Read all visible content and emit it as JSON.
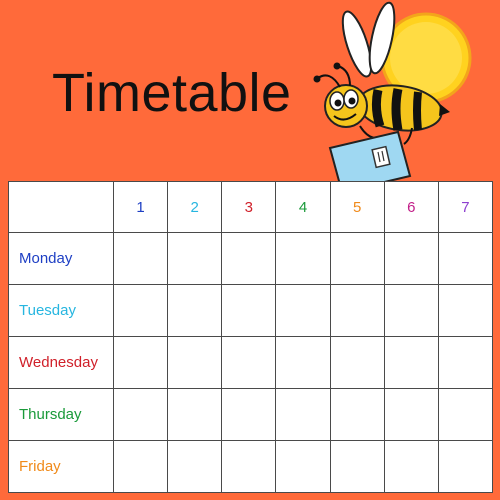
{
  "title": "Timetable",
  "periods": [
    "1",
    "2",
    "3",
    "4",
    "5",
    "6",
    "7"
  ],
  "period_colors": [
    "#1e3fc4",
    "#27b6e0",
    "#d0202a",
    "#1a9a3a",
    "#f08a1a",
    "#c21e88",
    "#8d3fcf"
  ],
  "days": [
    {
      "label": "Monday",
      "color": "#1e3fc4"
    },
    {
      "label": "Tuesday",
      "color": "#27b6e0"
    },
    {
      "label": "Wednesday",
      "color": "#d0202a"
    },
    {
      "label": "Thursday",
      "color": "#1a9a3a"
    },
    {
      "label": "Friday",
      "color": "#f08a1a"
    }
  ],
  "colors": {
    "background": "#ff6a3a",
    "grid_line": "#4a4a4a",
    "sun": "#ffd21f",
    "bee_body": "#f5c51c",
    "envelope": "#9fd8f2"
  },
  "icons": [
    "bee-icon",
    "sun-icon",
    "envelope-icon"
  ]
}
